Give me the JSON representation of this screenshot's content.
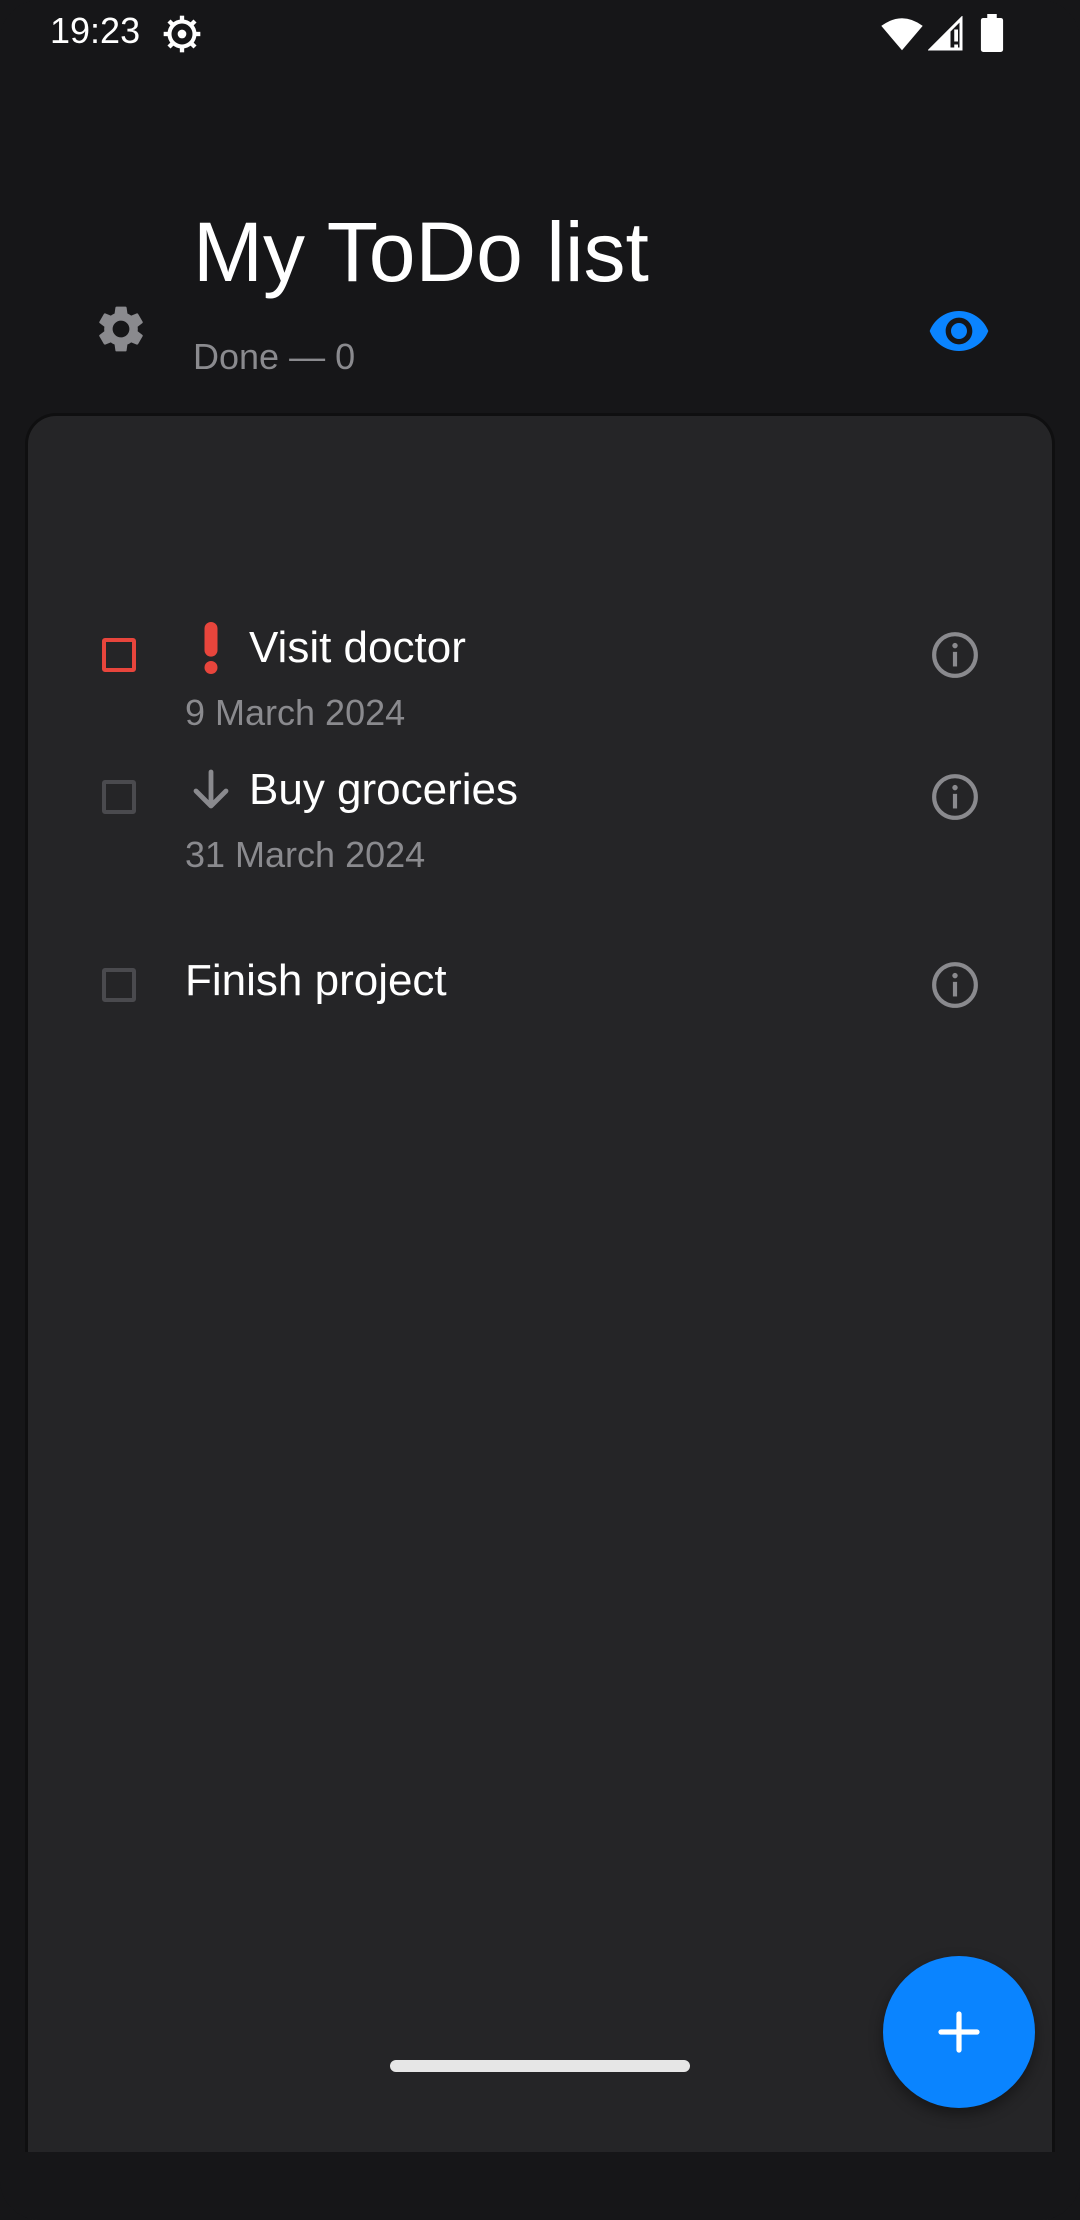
{
  "status_bar": {
    "time": "19:23",
    "icons": [
      "settings-gear-icon",
      "wifi-icon",
      "signal-icon",
      "battery-icon"
    ]
  },
  "header": {
    "title": "My ToDo list",
    "done_count": "Done — 0",
    "settings_icon": "gear-icon",
    "visibility_icon": "eye-icon"
  },
  "tasks": [
    {
      "title": "Visit doctor",
      "date": "9 March 2024",
      "priority": "high",
      "priority_icon": "exclamation-icon",
      "done": false
    },
    {
      "title": "Buy groceries",
      "date": "31 March 2024",
      "priority": "low",
      "priority_icon": "arrow-down-icon",
      "done": false
    },
    {
      "title": "Finish project",
      "date": "",
      "priority": "normal",
      "priority_icon": "",
      "done": false
    }
  ],
  "fab": {
    "icon": "plus-icon"
  },
  "colors": {
    "accent": "#0a84ff",
    "high_priority": "#e8453c",
    "background": "#161618",
    "card": "#252527",
    "secondary_text": "#8a8a8e"
  }
}
